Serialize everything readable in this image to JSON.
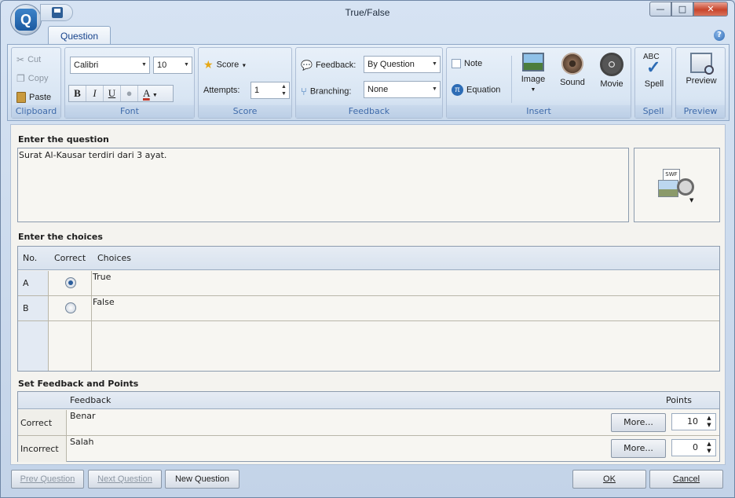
{
  "window": {
    "title": "True/False",
    "minimize": "—",
    "maximize": "□",
    "close": "✕"
  },
  "ribbon": {
    "tab": "Question",
    "help": "?",
    "clipboard": {
      "label": "Clipboard",
      "cut": "Cut",
      "copy": "Copy",
      "paste": "Paste"
    },
    "font": {
      "label": "Font",
      "family": "Calibri",
      "size": "10",
      "bold": "B",
      "italic": "I",
      "underline": "U",
      "color_letter": "A"
    },
    "score": {
      "label": "Score",
      "score_button": "Score",
      "attempts_label": "Attempts:",
      "attempts_value": "1"
    },
    "feedback": {
      "label": "Feedback",
      "feedback_label": "Feedback:",
      "feedback_value": "By Question",
      "branching_label": "Branching:",
      "branching_value": "None"
    },
    "insert": {
      "label": "Insert",
      "note": "Note",
      "equation": "Equation",
      "image": "Image",
      "sound": "Sound",
      "movie": "Movie"
    },
    "spell": {
      "label": "Spell",
      "button": "Spell",
      "abc": "ABC"
    },
    "preview": {
      "label": "Preview",
      "button": "Preview"
    }
  },
  "question": {
    "section_title": "Enter the question",
    "text": "Surat Al-Kausar terdiri dari 3 ayat.",
    "media_badge": "SWF"
  },
  "choices": {
    "section_title": "Enter the choices",
    "headers": {
      "no": "No.",
      "correct": "Correct",
      "choices": "Choices"
    },
    "rows": [
      {
        "no": "A",
        "text": "True",
        "correct": true
      },
      {
        "no": "B",
        "text": "False",
        "correct": false
      }
    ]
  },
  "feedback_points": {
    "section_title": "Set Feedback and Points",
    "headers": {
      "feedback": "Feedback",
      "points": "Points"
    },
    "rows": [
      {
        "label": "Correct",
        "text": "Benar",
        "more": "More...",
        "points": "10"
      },
      {
        "label": "Incorrect",
        "text": "Salah",
        "more": "More...",
        "points": "0"
      }
    ]
  },
  "buttons": {
    "prev": "Prev Question",
    "next": "Next Question",
    "new": "New Question",
    "ok": "OK",
    "cancel": "Cancel"
  }
}
